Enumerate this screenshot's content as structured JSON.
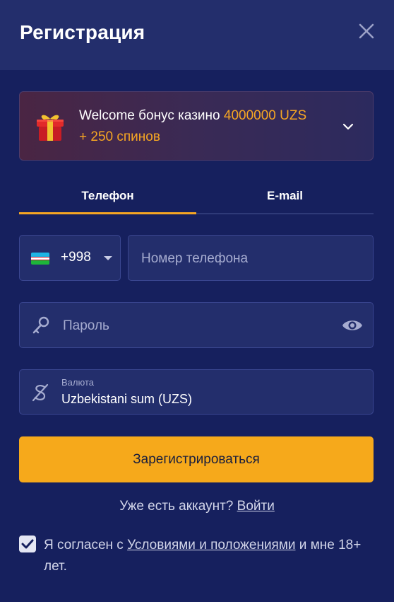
{
  "header": {
    "title": "Регистрация",
    "close_icon": "close-icon"
  },
  "bonus": {
    "icon": "gift-icon",
    "text_prefix": "Welcome бонус казино ",
    "amount": "4000000 UZS",
    "spins": "+ 250 спинов",
    "expand_icon": "chevron-down-icon"
  },
  "tabs": [
    {
      "label": "Телефон",
      "active": true
    },
    {
      "label": "E-mail",
      "active": false
    }
  ],
  "phone": {
    "country_flag": "uzbekistan-flag-icon",
    "country_code": "+998",
    "placeholder": "Номер телефона",
    "value": ""
  },
  "password": {
    "icon": "key-icon",
    "placeholder": "Пароль",
    "value": "",
    "toggle_icon": "eye-icon"
  },
  "currency": {
    "icon": "currency-icon",
    "label": "Валюта",
    "value": "Uzbekistani sum (UZS)"
  },
  "submit": {
    "label": "Зарегистрироваться"
  },
  "login": {
    "text": "Уже есть аккаунт? ",
    "link": "Войти"
  },
  "agree": {
    "checked": true,
    "text_before": "Я согласен с ",
    "terms_link": "Условиями и положениями",
    "text_after": " и мне 18+ лет."
  },
  "colors": {
    "accent": "#f6a623",
    "background": "#16205e",
    "header": "#232e6c",
    "field": "#232e6c",
    "button": "#f6a91b"
  }
}
